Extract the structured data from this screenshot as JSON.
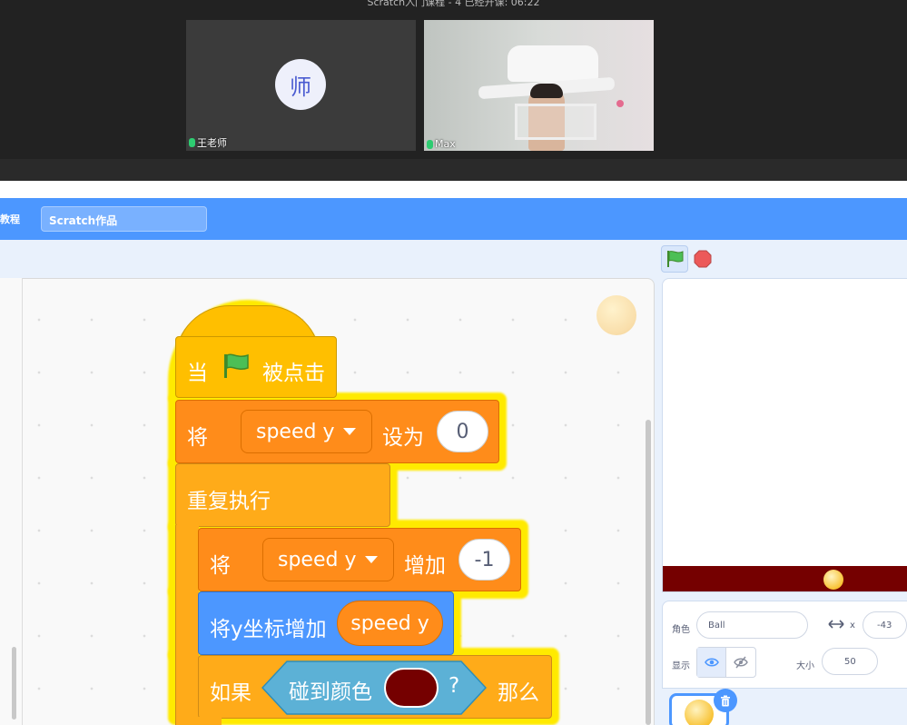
{
  "call": {
    "title": "Scratch入门课程 - 4 已经开课: 06:22",
    "teacher": {
      "avatar_char": "师",
      "name": "王老师"
    },
    "student": {
      "name": "Max"
    }
  },
  "menubar": {
    "tutorial_label": "教程",
    "project_title": "Scratch作品"
  },
  "blocks": {
    "when_label": "当",
    "clicked_label": "被点击",
    "set_prefix": "将",
    "set_var": "speed y",
    "set_to": "设为",
    "set_value": "0",
    "forever": "重复执行",
    "change_prefix": "将",
    "change_var": "speed y",
    "change_by": "增加",
    "change_value": "-1",
    "change_y_label": "将y坐标增加",
    "change_y_reporter": "speed y",
    "if_label": "如果",
    "touching_color": "碰到颜色",
    "question": "?",
    "then_label": "那么",
    "touch_color_hex": "#750000"
  },
  "sprite_info": {
    "sprite_label": "角色",
    "sprite_name": "Ball",
    "x_label": "x",
    "x_value": "-43",
    "show_label": "显示",
    "size_label": "大小",
    "size_value": "50"
  },
  "colors": {
    "menubar": "#4c97ff",
    "event_block": "#ffbf00",
    "variable_block": "#ff8c1a",
    "control_block": "#ffab19",
    "motion_block": "#4c97ff",
    "sensing_block": "#5cb1d6",
    "glow": "#ffea00",
    "stage_floor": "#750000"
  }
}
